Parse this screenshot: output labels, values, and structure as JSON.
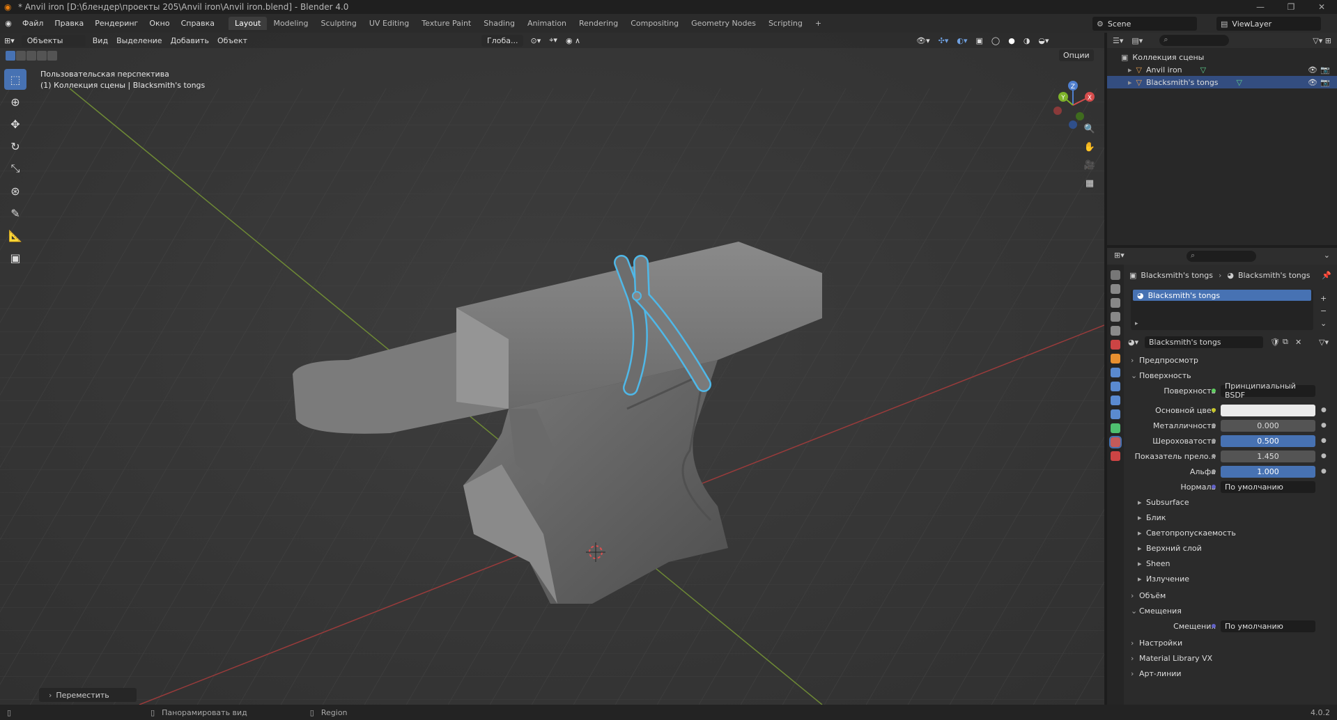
{
  "window": {
    "title": "* Anvil iron [D:\\блендер\\проекты 205\\Anvil iron\\Anvil iron.blend] - Blender 4.0",
    "controls": [
      "—",
      "❐",
      "✕"
    ]
  },
  "menu": [
    "Файл",
    "Правка",
    "Рендеринг",
    "Окно",
    "Справка"
  ],
  "workspaces": [
    "Layout",
    "Modeling",
    "Sculpting",
    "UV Editing",
    "Texture Paint",
    "Shading",
    "Animation",
    "Rendering",
    "Compositing",
    "Geometry Nodes",
    "Scripting",
    "+"
  ],
  "active_workspace": "Layout",
  "scene": {
    "label": "Scene",
    "view_layer": "ViewLayer"
  },
  "viewport": {
    "mode": "Объекты",
    "menus": [
      "Вид",
      "Выделение",
      "Добавить",
      "Объект"
    ],
    "transform": "Глоба...",
    "options": "Опции",
    "overlay_line1": "Пользовательская перспектива",
    "overlay_line2": "(1) Коллекция сцены | Blacksmith's tongs",
    "last_op": "Переместить",
    "axes": {
      "x": "X",
      "y": "Y",
      "z": "Z"
    }
  },
  "outliner": {
    "root": "Коллекция сцены",
    "items": [
      "Anvil iron",
      "Blacksmith's tongs"
    ],
    "selected_index": 1
  },
  "properties": {
    "breadcrumb_object": "Blacksmith's tongs",
    "breadcrumb_material": "Blacksmith's tongs",
    "slot": "Blacksmith's tongs",
    "material_name": "Blacksmith's tongs",
    "sections": {
      "preview": "Предпросмотр",
      "surface": "Поверхность",
      "volume": "Объём",
      "displacement": "Смещения",
      "settings": "Настройки",
      "matlib": "Material Library VX",
      "lineart": "Арт-линии"
    },
    "surface_label": "Поверхность",
    "surface_value": "Принципиальный BSDF",
    "fields": [
      {
        "label": "Основной цвет",
        "value": "",
        "type": "color"
      },
      {
        "label": "Металличность",
        "value": "0.000",
        "type": "num"
      },
      {
        "label": "Шероховатость",
        "value": "0.500",
        "type": "blue"
      },
      {
        "label": "Показатель прело...",
        "value": "1.450",
        "type": "num"
      },
      {
        "label": "Альфа",
        "value": "1.000",
        "type": "blue"
      },
      {
        "label": "Нормаль",
        "value": "По умолчанию",
        "type": "left"
      }
    ],
    "subpanels": [
      "Subsurface",
      "Блик",
      "Светопропускаемость",
      "Верхний слой",
      "Sheen",
      "Излучение"
    ],
    "disp_label": "Смещения",
    "disp_value": "По умолчанию"
  },
  "status": {
    "left": "Панорамировать вид",
    "mid": "Region",
    "version": "4.0.2"
  }
}
